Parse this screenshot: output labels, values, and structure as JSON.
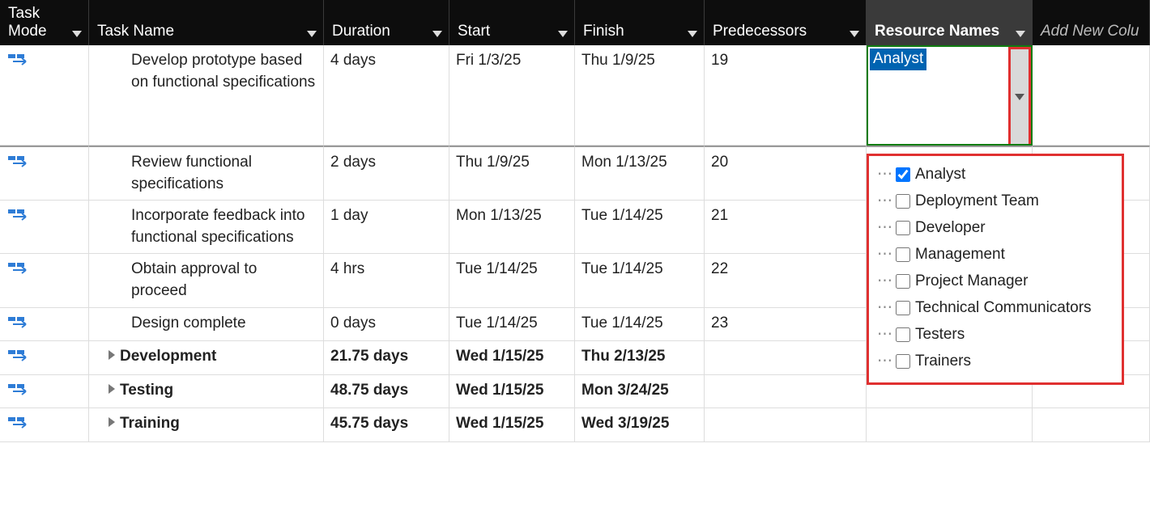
{
  "columns": {
    "mode": "Task Mode",
    "name": "Task Name",
    "duration": "Duration",
    "start": "Start",
    "finish": "Finish",
    "predecessors": "Predecessors",
    "resources": "Resource Names",
    "addnew": "Add New Colu"
  },
  "rows": [
    {
      "name": "Develop prototype based on functional specifications",
      "duration": "4 days",
      "start": "Fri 1/3/25",
      "finish": "Thu 1/9/25",
      "pred": "19",
      "res": "Analyst"
    },
    {
      "name": "Review functional specifications",
      "duration": "2 days",
      "start": "Thu 1/9/25",
      "finish": "Mon 1/13/25",
      "pred": "20",
      "res": ""
    },
    {
      "name": "Incorporate feedback into functional specifications",
      "duration": "1 day",
      "start": "Mon 1/13/25",
      "finish": "Tue 1/14/25",
      "pred": "21",
      "res": ""
    },
    {
      "name": "Obtain approval to proceed",
      "duration": "4 hrs",
      "start": "Tue 1/14/25",
      "finish": "Tue 1/14/25",
      "pred": "22",
      "res": ""
    },
    {
      "name": "Design complete",
      "duration": "0 days",
      "start": "Tue 1/14/25",
      "finish": "Tue 1/14/25",
      "pred": "23",
      "res": ""
    },
    {
      "name": "Development",
      "duration": "21.75 days",
      "start": "Wed 1/15/25",
      "finish": "Thu 2/13/25",
      "pred": "",
      "res": "",
      "bold": true,
      "expand": true
    },
    {
      "name": "Testing",
      "duration": "48.75 days",
      "start": "Wed 1/15/25",
      "finish": "Mon 3/24/25",
      "pred": "",
      "res": "",
      "bold": true,
      "expand": true
    },
    {
      "name": "Training",
      "duration": "45.75 days",
      "start": "Wed 1/15/25",
      "finish": "Wed 3/19/25",
      "pred": "",
      "res": "",
      "bold": true,
      "expand": true
    }
  ],
  "dropdown": {
    "selected": "Analyst",
    "options": [
      {
        "label": "Analyst",
        "checked": true
      },
      {
        "label": "Deployment Team",
        "checked": false
      },
      {
        "label": "Developer",
        "checked": false
      },
      {
        "label": "Management",
        "checked": false
      },
      {
        "label": "Project Manager",
        "checked": false
      },
      {
        "label": "Technical Communicators",
        "checked": false
      },
      {
        "label": "Testers",
        "checked": false
      },
      {
        "label": "Trainers",
        "checked": false
      }
    ]
  }
}
